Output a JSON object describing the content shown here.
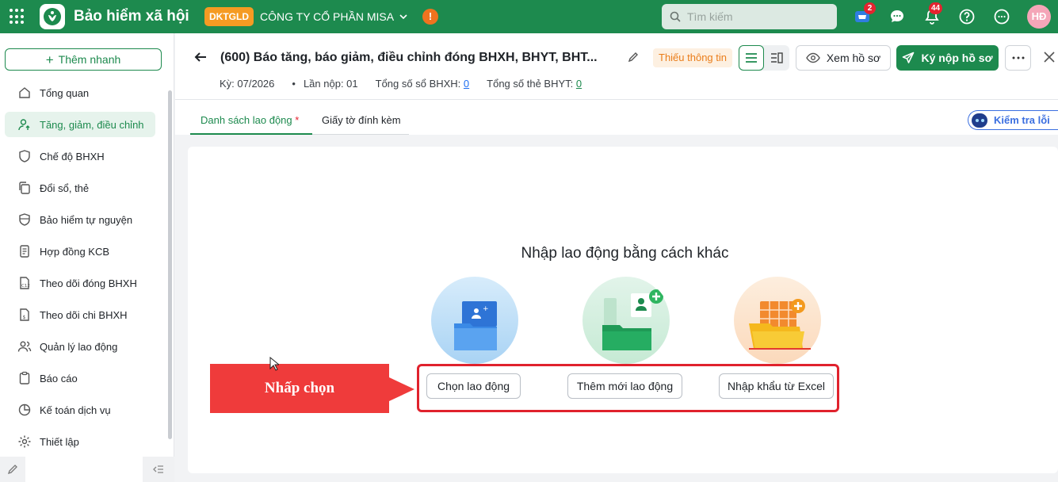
{
  "topbar": {
    "app_title": "Bảo hiểm xã hội",
    "org_code": "DKTGLD",
    "company": "CÔNG TY CỔ PHẦN MISA",
    "warning_symbol": "!",
    "search_placeholder": "Tìm kiếm",
    "cart_count": "2",
    "notification_count": "44",
    "avatar_initials": "HĐ"
  },
  "sidebar": {
    "quick_add": "Thêm nhanh",
    "items": [
      {
        "label": "Tổng quan",
        "icon": "home-icon"
      },
      {
        "label": "Tăng, giảm, điều chỉnh",
        "icon": "user-up-icon",
        "active": true
      },
      {
        "label": "Chế độ BHXH",
        "icon": "shield-heart-icon"
      },
      {
        "label": "Đổi sổ, thẻ",
        "icon": "copy-icon"
      },
      {
        "label": "Bảo hiểm tự nguyện",
        "icon": "shield-icon"
      },
      {
        "label": "Hợp đồng KCB",
        "icon": "contract-icon"
      },
      {
        "label": "Theo dõi đóng BHXH",
        "icon": "doc-c12-icon"
      },
      {
        "label": "Theo dõi chi BHXH",
        "icon": "doc-money-icon"
      },
      {
        "label": "Quản lý lao động",
        "icon": "users-icon"
      },
      {
        "label": "Báo cáo",
        "icon": "clipboard-icon"
      },
      {
        "label": "Kế toán dịch vụ",
        "icon": "chart-icon"
      },
      {
        "label": "Thiết lập",
        "icon": "gear-icon"
      }
    ]
  },
  "header": {
    "title": "(600) Báo tăng, báo giảm, điều chỉnh đóng BHXH, BHYT, BHT...",
    "status": "Thiếu thông tin",
    "view_button": "Xem hồ sơ",
    "submit_button": "Ký nộp hồ sơ",
    "period": "Kỳ: 07/2026",
    "submission": "Lần nộp: 01",
    "bhxh_label": "Tổng số sổ BHXH:",
    "bhxh_count": "0",
    "bhyt_label": "Tổng số thẻ BHYT:",
    "bhyt_count": "0"
  },
  "tabs": {
    "employees": "Danh sách lao động",
    "required_mark": "*",
    "attachments": "Giấy tờ đính kèm",
    "check_errors": "Kiểm tra lỗi"
  },
  "content": {
    "title": "Nhập lao động bằng cách khác",
    "options": [
      "Chọn lao động",
      "Thêm mới lao động",
      "Nhập khẩu từ Excel"
    ]
  },
  "annotation": {
    "label": "Nhấp chọn"
  },
  "colors": {
    "brand": "#1d8a4e",
    "warning": "#f59b23",
    "highlight": "#e0222d"
  }
}
